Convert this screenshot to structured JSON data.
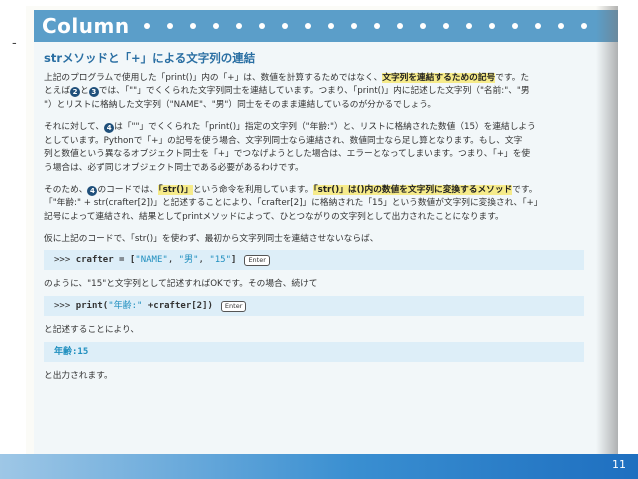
{
  "page": {
    "left_mark": "-",
    "page_number": "11"
  },
  "column": {
    "title": "Column",
    "heading": "strメソッドと「+」による文字列の連結"
  },
  "para1": {
    "l1a": "上記のプログラムで使用した「print()」内の「+」は、数値を計算するためではなく、",
    "l1b": "文字列を連結するための記号",
    "l1c": "です。た",
    "l2a": "とえば",
    "c2": "2",
    "l2b": "と",
    "c3": "3",
    "l2c": "では、「\"\"」でくくられた文字列同士を連結しています。つまり、「print()」内に記述した文字列（\"名前:\"、\"男",
    "l3": "\"）とリストに格納した文字列（\"NAME\"、\"男\"）同士をそのまま連結しているのが分かるでしょう。"
  },
  "para2": {
    "l1a": "それに対して、",
    "c4": "4",
    "l1b": "は「\"\"」でくくられた「print()」指定の文字列（\"年齢:\"）と、リストに格納された数値（15）を連結しよう",
    "l2": "としています。Pythonで「+」の記号を使う場合、文字列同士なら連結され、数値同士なら足し算となります。もし、文字",
    "l3": "列と数値という異なるオブジェクト同士を「+」でつなげようとした場合は、エラーとなってしまいます。つまり、「+」を使",
    "l4": "う場合は、必ず同じオブジェクト同士である必要があるわけです。"
  },
  "para3": {
    "l1a": "そのため、",
    "c4": "4",
    "l1b": "のコードでは、",
    "l1c": "「str()」",
    "l1d": "という命令を利用しています。",
    "l1e": "「str()」は()内の数値を文字列に変換するメソッド",
    "l1f": "です。",
    "l2": "「\"年齢:\" + str(crafter[2])」と記述することにより、「crafter[2]」に格納された「15」という数値が文字列に変換され、「+」",
    "l3": "記号によって連結され、結果としてprintメソッドによって、ひとつながりの文字列として出力されたことになります。"
  },
  "para4": {
    "l1": "仮に上記のコードで、「str()」を使わず、最初から文字列同士を連結させないならば、"
  },
  "code1": {
    "prompt": ">>> ",
    "var": "crafter = [",
    "s1": "\"NAME\"",
    "comma1": ", ",
    "s2": "\"男\"",
    "comma2": ", ",
    "s3": "\"15\"",
    "end": "]",
    "key": "Enter"
  },
  "para5": {
    "l1": "のように、\"15\"と文字列として記述すればOKです。その場合、続けて"
  },
  "code2": {
    "prompt": ">>> ",
    "fn": "print(",
    "s1": "\"年齢:\"",
    "rest": " +crafter[2])",
    "key": "Enter"
  },
  "para6": {
    "l1": "と記述することにより、"
  },
  "output": {
    "text": "年齢:15"
  },
  "para7": {
    "l1": "と出力されます。"
  },
  "colors": {
    "header_blue": "#5b9ec9",
    "heading_blue": "#2a6fa3",
    "highlight_yellow": "#f6eb8a",
    "code_bg": "#ddeef8",
    "string_blue": "#1f8fbf",
    "bottom_bar": "#1e6fc0"
  }
}
